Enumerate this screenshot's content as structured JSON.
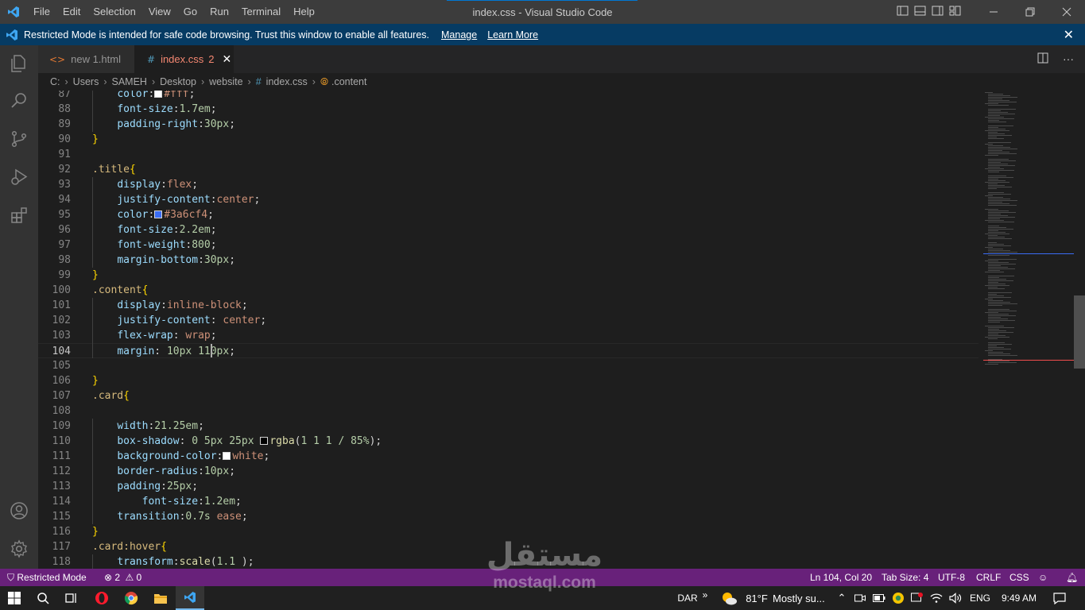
{
  "window": {
    "title": "index.css - Visual Studio Code",
    "menu": [
      "File",
      "Edit",
      "Selection",
      "View",
      "Go",
      "Run",
      "Terminal",
      "Help"
    ]
  },
  "banner": {
    "message": "Restricted Mode is intended for safe code browsing. Trust this window to enable all features.",
    "manage_label": "Manage",
    "learn_more_label": "Learn More"
  },
  "tabs": [
    {
      "label": "new 1.html",
      "icon": "<>"
    },
    {
      "label": "index.css",
      "icon": "#",
      "count": "2"
    }
  ],
  "breadcrumb": [
    "C:",
    "Users",
    "SAMEH",
    "Desktop",
    "website",
    "index.css",
    ".content"
  ],
  "editor": {
    "active_line": 104,
    "lines": [
      {
        "n": "87",
        "tokens": [
          [
            "",
            "    "
          ],
          [
            "tk-prop",
            "color"
          ],
          [
            "tk-pu",
            ":"
          ],
          [
            "swatch",
            "#ffffff"
          ],
          [
            "tk-val",
            "#fff"
          ],
          [
            "tk-pu",
            ";"
          ]
        ]
      },
      {
        "n": "88",
        "tokens": [
          [
            "",
            "    "
          ],
          [
            "tk-prop",
            "font-size"
          ],
          [
            "tk-pu",
            ":"
          ],
          [
            "tk-num",
            "1.7em"
          ],
          [
            "tk-pu",
            ";"
          ]
        ]
      },
      {
        "n": "89",
        "tokens": [
          [
            "",
            "    "
          ],
          [
            "tk-prop",
            "padding-right"
          ],
          [
            "tk-pu",
            ":"
          ],
          [
            "tk-num",
            "30px"
          ],
          [
            "tk-pu",
            ";"
          ]
        ]
      },
      {
        "n": "90",
        "tokens": [
          [
            "tk-br",
            "}"
          ]
        ]
      },
      {
        "n": "91",
        "tokens": []
      },
      {
        "n": "92",
        "tokens": [
          [
            "tk-sel",
            ".title"
          ],
          [
            "tk-br",
            "{"
          ]
        ]
      },
      {
        "n": "93",
        "tokens": [
          [
            "",
            "    "
          ],
          [
            "tk-prop",
            "display"
          ],
          [
            "tk-pu",
            ":"
          ],
          [
            "tk-val",
            "flex"
          ],
          [
            "tk-pu",
            ";"
          ]
        ]
      },
      {
        "n": "94",
        "tokens": [
          [
            "",
            "    "
          ],
          [
            "tk-prop",
            "justify-content"
          ],
          [
            "tk-pu",
            ":"
          ],
          [
            "tk-val",
            "center"
          ],
          [
            "tk-pu",
            ";"
          ]
        ]
      },
      {
        "n": "95",
        "tokens": [
          [
            "",
            "    "
          ],
          [
            "tk-prop",
            "color"
          ],
          [
            "tk-pu",
            ":"
          ],
          [
            "swatch",
            "#3a6cf4"
          ],
          [
            "tk-val",
            "#3a6cf4"
          ],
          [
            "tk-pu",
            ";"
          ]
        ]
      },
      {
        "n": "96",
        "tokens": [
          [
            "",
            "    "
          ],
          [
            "tk-prop",
            "font-size"
          ],
          [
            "tk-pu",
            ":"
          ],
          [
            "tk-num",
            "2.2em"
          ],
          [
            "tk-pu",
            ";"
          ]
        ]
      },
      {
        "n": "97",
        "tokens": [
          [
            "",
            "    "
          ],
          [
            "tk-prop",
            "font-weight"
          ],
          [
            "tk-pu",
            ":"
          ],
          [
            "tk-num",
            "800"
          ],
          [
            "tk-pu",
            ";"
          ]
        ]
      },
      {
        "n": "98",
        "tokens": [
          [
            "",
            "    "
          ],
          [
            "tk-prop",
            "margin-bottom"
          ],
          [
            "tk-pu",
            ":"
          ],
          [
            "tk-num",
            "30px"
          ],
          [
            "tk-pu",
            ";"
          ]
        ]
      },
      {
        "n": "99",
        "tokens": [
          [
            "tk-br",
            "}"
          ]
        ]
      },
      {
        "n": "100",
        "tokens": [
          [
            "tk-sel",
            ".content"
          ],
          [
            "tk-br",
            "{"
          ]
        ]
      },
      {
        "n": "101",
        "tokens": [
          [
            "",
            "    "
          ],
          [
            "tk-prop",
            "display"
          ],
          [
            "tk-pu",
            ":"
          ],
          [
            "tk-val",
            "inline-block"
          ],
          [
            "tk-pu",
            ";"
          ]
        ]
      },
      {
        "n": "102",
        "tokens": [
          [
            "",
            "    "
          ],
          [
            "tk-prop",
            "justify-content"
          ],
          [
            "tk-pu",
            ": "
          ],
          [
            "tk-val",
            "center"
          ],
          [
            "tk-pu",
            ";"
          ]
        ]
      },
      {
        "n": "103",
        "tokens": [
          [
            "",
            "    "
          ],
          [
            "tk-prop",
            "flex-wrap"
          ],
          [
            "tk-pu",
            ": "
          ],
          [
            "tk-val",
            "wrap"
          ],
          [
            "tk-pu",
            ";"
          ]
        ]
      },
      {
        "n": "104",
        "tokens": [
          [
            "",
            "    "
          ],
          [
            "tk-prop",
            "margin"
          ],
          [
            "tk-pu",
            ": "
          ],
          [
            "tk-num",
            "10px 110px"
          ],
          [
            "tk-pu",
            ";"
          ]
        ]
      },
      {
        "n": "105",
        "tokens": []
      },
      {
        "n": "106",
        "tokens": [
          [
            "tk-br",
            "}"
          ]
        ]
      },
      {
        "n": "107",
        "tokens": [
          [
            "tk-sel",
            ".card"
          ],
          [
            "tk-br",
            "{"
          ]
        ]
      },
      {
        "n": "108",
        "tokens": []
      },
      {
        "n": "109",
        "tokens": [
          [
            "",
            "    "
          ],
          [
            "tk-prop",
            "width"
          ],
          [
            "tk-pu",
            ":"
          ],
          [
            "tk-num",
            "21.25em"
          ],
          [
            "tk-pu",
            ";"
          ]
        ]
      },
      {
        "n": "110",
        "tokens": [
          [
            "",
            "    "
          ],
          [
            "tk-prop",
            "box-shadow"
          ],
          [
            "tk-pu",
            ": "
          ],
          [
            "tk-num",
            "0 5px 25px "
          ],
          [
            "swatch",
            "#010101"
          ],
          [
            "tk-fn",
            "rgba"
          ],
          [
            "tk-pu",
            "("
          ],
          [
            "tk-num",
            "1 1 1 / 85%"
          ],
          [
            "tk-pu",
            ");"
          ]
        ]
      },
      {
        "n": "111",
        "tokens": [
          [
            "",
            "    "
          ],
          [
            "tk-prop",
            "background-color"
          ],
          [
            "tk-pu",
            ":"
          ],
          [
            "swatch",
            "#ffffff"
          ],
          [
            "tk-val",
            "white"
          ],
          [
            "tk-pu",
            ";"
          ]
        ]
      },
      {
        "n": "112",
        "tokens": [
          [
            "",
            "    "
          ],
          [
            "tk-prop",
            "border-radius"
          ],
          [
            "tk-pu",
            ":"
          ],
          [
            "tk-num",
            "10px"
          ],
          [
            "tk-pu",
            ";"
          ]
        ]
      },
      {
        "n": "113",
        "tokens": [
          [
            "",
            "    "
          ],
          [
            "tk-prop",
            "padding"
          ],
          [
            "tk-pu",
            ":"
          ],
          [
            "tk-num",
            "25px"
          ],
          [
            "tk-pu",
            ";"
          ]
        ]
      },
      {
        "n": "114",
        "tokens": [
          [
            "",
            "        "
          ],
          [
            "tk-prop",
            "font-size"
          ],
          [
            "tk-pu",
            ":"
          ],
          [
            "tk-num",
            "1.2em"
          ],
          [
            "tk-pu",
            ";"
          ]
        ]
      },
      {
        "n": "115",
        "tokens": [
          [
            "",
            "    "
          ],
          [
            "tk-prop",
            "transition"
          ],
          [
            "tk-pu",
            ":"
          ],
          [
            "tk-num",
            "0.7s "
          ],
          [
            "tk-val",
            "ease"
          ],
          [
            "tk-pu",
            ";"
          ]
        ]
      },
      {
        "n": "116",
        "tokens": [
          [
            "tk-br",
            "}"
          ]
        ]
      },
      {
        "n": "117",
        "tokens": [
          [
            "tk-sel",
            ".card:hover"
          ],
          [
            "tk-br",
            "{"
          ]
        ]
      },
      {
        "n": "118",
        "tokens": [
          [
            "",
            "    "
          ],
          [
            "tk-prop",
            "transform"
          ],
          [
            "tk-pu",
            ":"
          ],
          [
            "tk-fn",
            "scale"
          ],
          [
            "tk-pu",
            "("
          ],
          [
            "tk-num",
            "1.1 "
          ],
          [
            "tk-pu",
            ");"
          ]
        ]
      },
      {
        "n": "119",
        "tokens": [
          [
            "tk-br",
            "}"
          ]
        ]
      }
    ]
  },
  "statusbar": {
    "restricted_mode": "Restricted Mode",
    "errors": "2",
    "warnings": "0",
    "position": "Ln 104, Col 20",
    "tab_size": "Tab Size: 4",
    "encoding": "UTF-8",
    "eol": "CRLF",
    "language": "CSS"
  },
  "taskbar": {
    "lang_indicator": "DAR",
    "weather_temp": "81°F",
    "weather_text": "Mostly su...",
    "keyboard_lang": "ENG",
    "time": "9:49 AM"
  },
  "watermark": {
    "arabic": "مستقل",
    "latin": "mostaql.com"
  },
  "colors": {
    "statusbar_bg": "#68217a",
    "banner_bg": "#063b63",
    "error_tab": "#f48771",
    "accent": "#0078d4"
  }
}
